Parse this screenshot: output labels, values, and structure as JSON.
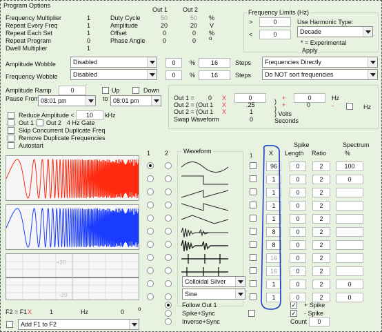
{
  "title": "Program Options",
  "hdr": {
    "out1": "Out 1",
    "out2": "Out 2"
  },
  "params": [
    {
      "label": "Frequency Multiplier",
      "v": "1"
    },
    {
      "label": "Repeat Every Freq",
      "v": "1"
    },
    {
      "label": "Repeat Each Set",
      "v": "1"
    },
    {
      "label": "Repeat Program",
      "v": "0"
    },
    {
      "label": "Dwell Multiplier",
      "v": "1"
    }
  ],
  "duty": {
    "label": "Duty Cycle",
    "o1": "50",
    "o2": "50",
    "unit": "%"
  },
  "amplitude": {
    "label": "Amplitude",
    "o1": "20",
    "o2": "20",
    "unit": "V"
  },
  "offset": {
    "label": "Offset",
    "o1": "0",
    "o2": "0",
    "unit": "%"
  },
  "phase": {
    "label": "Phase Angle",
    "o1": "0",
    "o2": "0",
    "unit": "o"
  },
  "freq_limits": {
    "title": "Frequency Limits (Hz)",
    "gt": ">",
    "gt_v": "0",
    "lt": "<",
    "lt_v": "0",
    "harm_label": "Use Harmonic Type:",
    "harm_value": "Decade",
    "exp": "* = Experimental",
    "apply": "Apply"
  },
  "amp_wobble": {
    "label": "Amplitude Wobble",
    "value": "Disabled",
    "pct": "0",
    "pct_u": "%",
    "steps": "16",
    "steps_u": "Steps",
    "right": "Frequencies Directly"
  },
  "freq_wobble": {
    "label": "Frequency Wobble",
    "value": "Disabled",
    "pct": "0",
    "pct_u": "%",
    "steps": "16",
    "steps_u": "Steps",
    "right": "Do NOT sort frequencies"
  },
  "ramp": {
    "label": "Amplitude Ramp",
    "v": "0",
    "up": "Up",
    "down": "Down"
  },
  "pause": {
    "label": "Pause From",
    "from": "08:01 pm",
    "to_label": "to",
    "to": "08:01 pm"
  },
  "mix": {
    "l1": "Out 1 =",
    "v1": "0",
    "x1": "X",
    "l2": "Out 2 = (Out 1",
    "x2": "X",
    "l3": "Out 2 = (Out 1",
    "x3": "X",
    "swap": "Swap Waveform",
    "c1": "0",
    "c2": ".25",
    "c3": "1",
    "c4": "0",
    "p1": ")",
    "plus1": "+",
    "h1": "0",
    "hz1": "Hz",
    "p2": ")",
    "plus2": "+",
    "h2": "0",
    "minus": "-",
    "hz2": "Hz",
    "volts": ") Volts",
    "seconds": "Seconds"
  },
  "options": [
    {
      "label": "Reduce Amplitude <",
      "v": "10",
      "u": "kHz"
    },
    {
      "label": "Out 1"
    },
    {
      "label": "Out 2"
    },
    {
      "label": "4 Hz Gate"
    },
    {
      "label": "Skip Concurrent Duplicate Freq"
    },
    {
      "label": "Remove Duplicate Frequencies"
    },
    {
      "label": "Autostart"
    }
  ],
  "cols": {
    "c1": "1",
    "c2": "2",
    "waveform": "Waveform",
    "one": "1",
    "x": "X",
    "spike": "Spike",
    "length": "Length",
    "ratio": "Ratio",
    "spectrum": "Spectrum",
    "pct": "%"
  },
  "rows": [
    {
      "x": "96",
      "len": "0",
      "ratio": "2",
      "spec": "100"
    },
    {
      "x": "1",
      "len": "0",
      "ratio": "2",
      "spec": "0"
    },
    {
      "x": "1",
      "len": "0",
      "ratio": "2",
      "spec": ""
    },
    {
      "x": "1",
      "len": "0",
      "ratio": "2",
      "spec": ""
    },
    {
      "x": "1",
      "len": "0",
      "ratio": "2",
      "spec": ""
    },
    {
      "x": "8",
      "len": "0",
      "ratio": "2",
      "spec": ""
    },
    {
      "x": "8",
      "len": "0",
      "ratio": "2",
      "spec": ""
    },
    {
      "x": "16",
      "len": "0",
      "ratio": "2",
      "spec": ""
    },
    {
      "x": "16",
      "len": "0",
      "ratio": "2",
      "spec": ""
    },
    {
      "x": "1",
      "len": "0",
      "ratio": "2",
      "spec": "0"
    },
    {
      "x": "1",
      "len": "0",
      "ratio": "2",
      "spec": "0"
    }
  ],
  "row10_select": "Colloidal Silver",
  "row11_select": "Sine",
  "scope": {
    "ypos": "+20",
    "yneg": "-20"
  },
  "f2": {
    "label": "F2 = F1",
    "x": "X",
    "v": "1",
    "hz": "Hz",
    "deg_v": "0",
    "deg": "o"
  },
  "add": "Add F1 to F2",
  "bottom_opts": [
    "Follow Out 1",
    "Spike+Sync",
    "Inverse+Sync"
  ],
  "spike_opts": {
    "plus": "+ Spike",
    "minus": "- Spike",
    "count_label": "Count",
    "count": "0",
    "check": "✓"
  },
  "colors": {
    "bg": "#e7f3e0",
    "red": "#ff2a10",
    "blue": "#1a3cff",
    "highlight": "#1b3fc4"
  }
}
